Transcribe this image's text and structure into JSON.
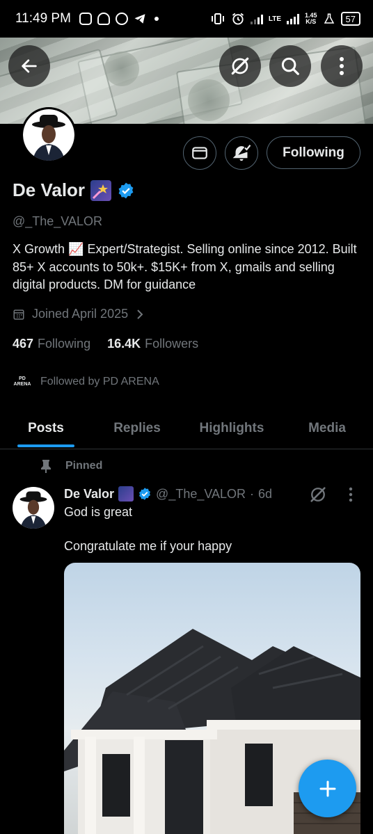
{
  "status_bar": {
    "time": "11:49 PM",
    "network": "LTE",
    "speed_value": "1.45",
    "speed_unit": "K/S",
    "battery": "57"
  },
  "header": {
    "back_icon": "arrow-left-icon",
    "grok_icon": "grok-slash-icon",
    "search_icon": "search-icon",
    "more_icon": "more-vertical-icon"
  },
  "profile": {
    "display_name": "De Valor",
    "handle": "@_The_VALOR",
    "bio": "X Growth 📈 Expert/Strategist. Selling online since 2012. Built 85+ X accounts to 50k+. $15K+ from X, gmails and selling digital products. DM for guidance",
    "joined": "Joined April 2025",
    "following_count": "467",
    "following_label": "Following",
    "followers_count": "16.4K",
    "followers_label": "Followers",
    "followed_by": "Followed by PD ARENA",
    "followed_by_logo_text": "PD",
    "followed_by_logo_sub": "ARENA",
    "following_button": "Following",
    "verified_color": "#1d9bf0"
  },
  "tabs": [
    {
      "label": "Posts",
      "active": true
    },
    {
      "label": "Replies",
      "active": false
    },
    {
      "label": "Highlights",
      "active": false
    },
    {
      "label": "Media",
      "active": false
    }
  ],
  "post": {
    "pinned_label": "Pinned",
    "author_name": "De Valor",
    "author_handle": "@_The_VALOR",
    "separator": "·",
    "time_ago": "6d",
    "text_line1": "God is great",
    "text_line2": "Congratulate me if your happy"
  },
  "fab_icon": "plus-icon",
  "accent_color": "#1d9bf0"
}
